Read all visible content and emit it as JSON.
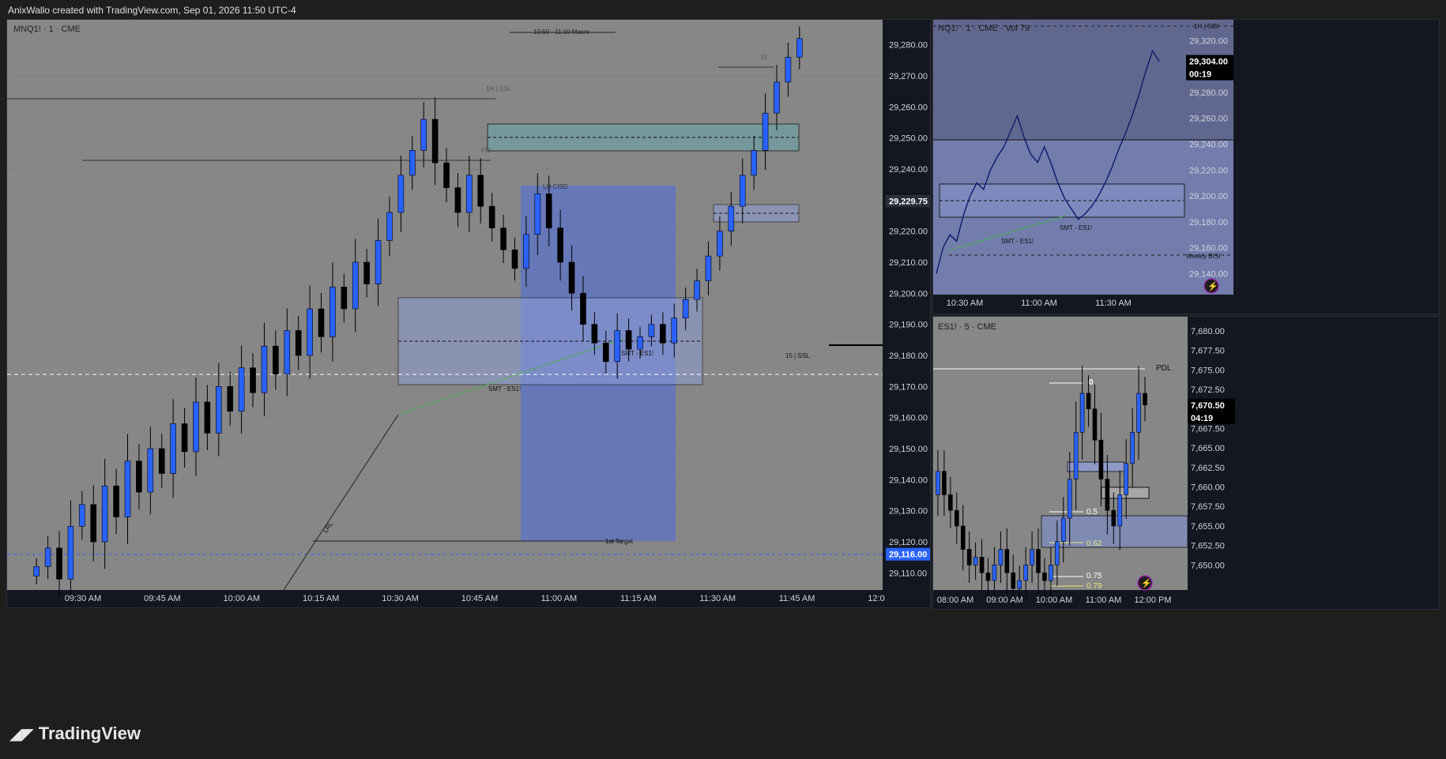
{
  "header": {
    "text": "AnixWallo created with TradingView.com, Sep 01, 2026 11:50 UTC-4"
  },
  "footer": {
    "brand": "TradingView",
    "logo_icon": "tradingview-logo-icon"
  },
  "colors": {
    "bg": "#878787",
    "up": "#2962ff",
    "down": "#000000",
    "zone": "#6f9ea3",
    "fvg": "#7f8cbf",
    "target": "#5b73c8"
  },
  "chart_data": [
    {
      "type": "candlestick",
      "symbol": "MNQ1! · 1 · CME",
      "yticks": [
        "29,280.00",
        "29,270.00",
        "29,260.00",
        "29,250.00",
        "29,240.00",
        "29,230.00",
        "29,220.00",
        "29,210.00",
        "29,200.00",
        "29,190.00",
        "29,180.00",
        "29,170.00",
        "29,160.00",
        "29,150.00",
        "29,140.00",
        "29,130.00",
        "29,120.00",
        "29,110.00"
      ],
      "xticks": [
        "09:30 AM",
        "09:45 AM",
        "10:00 AM",
        "10:15 AM",
        "10:30 AM",
        "10:45 AM",
        "11:00 AM",
        "11:15 AM",
        "11:30 AM",
        "11:45 AM",
        "12:0"
      ],
      "price_labels": [
        {
          "text": "29,230.00",
          "value": 29230,
          "bg": "#000000",
          "fg": "#ffffff"
        },
        {
          "text": "29,229.75",
          "value": 29229.75,
          "bg": "#2a2e39",
          "fg": "#ffffff"
        },
        {
          "text": "29,116.00",
          "value": 29116,
          "bg": "#2962ff",
          "fg": "#ffffff"
        }
      ],
      "annotations": [
        "10:50 - 11:10 Macro",
        "1H | SSL",
        "SMT - ES1!",
        "SMT - ES1!",
        "1st Target",
        "15 | SSL",
        "LRL",
        "PM",
        "15",
        "LH CISD"
      ],
      "ylim": [
        29105,
        29285
      ],
      "closes": [
        29112,
        29118,
        29108,
        29125,
        29132,
        29120,
        29138,
        29128,
        29146,
        29136,
        29150,
        29142,
        29158,
        29149,
        29165,
        29155,
        29170,
        29162,
        29176,
        29168,
        29183,
        29174,
        29188,
        29180,
        29195,
        29186,
        29202,
        29195,
        29210,
        29203,
        29217,
        29226,
        29238,
        29246,
        29256,
        29242,
        29234,
        29226,
        29238,
        29228,
        29221,
        29214,
        29208,
        29219,
        29232,
        29221,
        29210,
        29200,
        29190,
        29184,
        29178,
        29188,
        29182,
        29186,
        29190,
        29184,
        29192,
        29198,
        29204,
        29212,
        29220,
        29228,
        29238,
        29246,
        29258,
        29268,
        29276,
        29282
      ]
    },
    {
      "type": "line",
      "symbol": "NQ1! · 1 · CME · Vol 79",
      "yticks": [
        "29,320.00",
        "29,300.00",
        "29,280.00",
        "29,260.00",
        "29,240.00",
        "29,220.00",
        "29,200.00",
        "29,180.00",
        "29,160.00",
        "29,140.00"
      ],
      "xticks": [
        "10:30 AM",
        "11:00 AM",
        "11:30 AM"
      ],
      "price_labels": [
        {
          "text": "29,304.00",
          "value": 29304
        },
        {
          "text": "00:19"
        }
      ],
      "annotations": [
        "1H | SIBI",
        "SMT - ES1!",
        "SMT - ES1!",
        "Weekly BISI"
      ],
      "ylim": [
        29125,
        29330
      ],
      "values": [
        29140,
        29160,
        29170,
        29165,
        29185,
        29200,
        29210,
        29205,
        29220,
        29230,
        29238,
        29250,
        29262,
        29245,
        29232,
        29226,
        29238,
        29225,
        29210,
        29198,
        29190,
        29182,
        29186,
        29192,
        29200,
        29210,
        29222,
        29236,
        29248,
        29262,
        29278,
        29296,
        29312,
        29304
      ]
    },
    {
      "type": "candlestick",
      "symbol": "ES1! · 5 · CME",
      "yticks": [
        "7,680.00",
        "7,677.50",
        "7,675.00",
        "7,672.50",
        "7,670.00",
        "7,667.50",
        "7,665.00",
        "7,662.50",
        "7,660.00",
        "7,657.50",
        "7,655.00",
        "7,652.50",
        "7,650.00"
      ],
      "xticks": [
        "08:00 AM",
        "09:00 AM",
        "10:00 AM",
        "11:00 AM",
        "12:00 PM"
      ],
      "price_labels": [
        {
          "text": "7,670.50",
          "value": 7670.5
        },
        {
          "text": "04:19"
        }
      ],
      "fib_levels": [
        {
          "level": "0"
        },
        {
          "level": "0.5"
        },
        {
          "level": "0.62"
        },
        {
          "level": "0.75"
        },
        {
          "level": "0.79"
        }
      ],
      "annotations": [
        "PDL"
      ],
      "ylim": [
        7647,
        7681
      ],
      "closes": [
        7662,
        7659,
        7657,
        7655,
        7652,
        7650,
        7651,
        7649,
        7648,
        7650,
        7652,
        7649,
        7647,
        7648,
        7650,
        7652,
        7649,
        7648,
        7650,
        7653,
        7656,
        7661,
        7667,
        7672,
        7670,
        7666,
        7661,
        7657,
        7655,
        7659,
        7663,
        7667,
        7672,
        7670.5
      ]
    }
  ]
}
